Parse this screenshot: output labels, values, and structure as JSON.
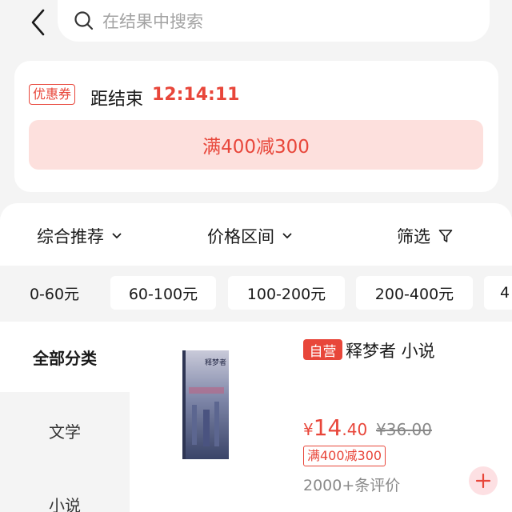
{
  "search": {
    "placeholder": "在结果中搜索"
  },
  "coupon": {
    "tag": "优惠券",
    "countdown_label": "距结束",
    "countdown_time": "12:14:11",
    "offer": "满400减300"
  },
  "sort_bar": {
    "items": [
      {
        "label": "综合推荐",
        "icon": "chevron-down-icon"
      },
      {
        "label": "价格区间",
        "icon": "chevron-down-icon"
      },
      {
        "label": "筛选",
        "icon": "filter-icon"
      }
    ]
  },
  "price_ranges": [
    "0-60元",
    "60-100元",
    "100-200元",
    "200-400元",
    "4"
  ],
  "categories": {
    "active": "全部分类",
    "items": [
      "文学",
      "小说"
    ]
  },
  "product": {
    "badge": "自营",
    "title": "释梦者 小说",
    "price_currency": "¥",
    "price_int": "14",
    "price_dec": ".40",
    "original_price": "¥36.00",
    "promo": "满400减300",
    "reviews": "2000+条评价",
    "cover_text": "释梦者"
  },
  "colors": {
    "accent": "#e8463a",
    "coupon_bg": "#fde0dd",
    "page_bg": "#f4f4f4"
  }
}
